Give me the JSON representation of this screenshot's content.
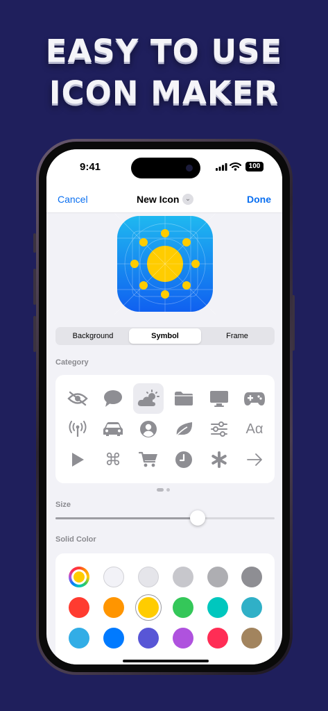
{
  "headline": {
    "line1": "EASY TO USE",
    "line2": "ICON MAKER"
  },
  "status_bar": {
    "time": "9:41",
    "battery": "100"
  },
  "nav": {
    "cancel": "Cancel",
    "title": "New Icon",
    "done": "Done"
  },
  "segments": [
    {
      "label": "Background",
      "selected": false
    },
    {
      "label": "Symbol",
      "selected": true
    },
    {
      "label": "Frame",
      "selected": false
    }
  ],
  "category_label": "Category",
  "categories": [
    "eye-slash-icon",
    "speech-bubble-icon",
    "cloud-sun-icon",
    "folder-icon",
    "display-icon",
    "gamecontroller-icon",
    "antenna-icon",
    "car-icon",
    "person-circle-icon",
    "leaf-icon",
    "sliders-icon",
    "text-format-icon",
    "play-icon",
    "command-icon",
    "cart-icon",
    "clock-icon",
    "asterisk-icon",
    "arrow-right-icon"
  ],
  "selected_category": "cloud-sun-icon",
  "text_format_glyph": "Aα",
  "page_indicator": {
    "pages": 2,
    "current": 1
  },
  "size_label": "Size",
  "size_value": 0.65,
  "solid_color_label": "Solid Color",
  "colors": [
    "#ffcc00",
    "#f2f2f7",
    "#e5e5ea",
    "#c7c7cc",
    "#aeaeb2",
    "#8e8e93",
    "#ff3b30",
    "#ff9500",
    "#ffcc00",
    "#34c759",
    "#00c7be",
    "#30b0c7",
    "#32ade6",
    "#007aff",
    "#5856d6",
    "#af52de",
    "#ff2d55",
    "#a2845e"
  ],
  "selected_color": "#ffcc00",
  "accent": "#0a6ff0",
  "preview_colors": {
    "gradient_top": "#1fb8f0",
    "gradient_bottom": "#1060f0",
    "symbol": "#ffcc00"
  }
}
